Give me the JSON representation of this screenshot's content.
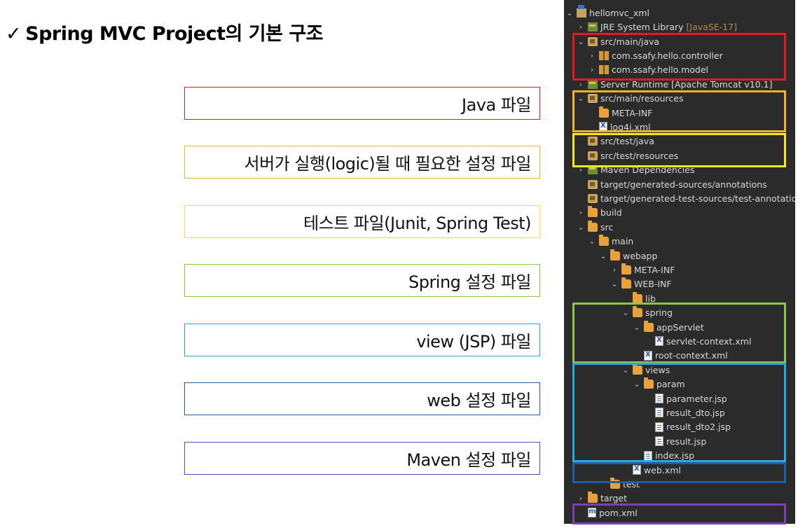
{
  "title": {
    "check": "✓",
    "text": "Spring MVC Project의 기본 구조"
  },
  "colors": {
    "red": "#e21b1b",
    "orange": "#f0b323",
    "yellow": "#f2ea1a",
    "green": "#8dc63f",
    "sky": "#27aae1",
    "blue": "#1c5ea8",
    "purple": "#7d3fb5"
  },
  "descriptions": [
    {
      "label": "Java 파일"
    },
    {
      "label": "서버가 실행(logic)될 때 필요한 설정 파일"
    },
    {
      "label": "테스트 파일(Junit, Spring Test)"
    },
    {
      "label": "Spring 설정 파일"
    },
    {
      "label": "view (JSP) 파일"
    },
    {
      "label": "web 설정 파일"
    },
    {
      "label": "Maven 설정 파일"
    }
  ],
  "tree": [
    {
      "label": "hellomvc_xml",
      "icon": "project-icon",
      "chevron": "open"
    },
    {
      "label": "JRE System Library",
      "extra": "[JavaSE-17]",
      "icon": "library-icon",
      "chevron": "closed"
    },
    {
      "label": "src/main/java",
      "icon": "package-folder-icon",
      "chevron": "open"
    },
    {
      "label": "com.ssafy.hello.controller",
      "icon": "package-icon",
      "chevron": "closed"
    },
    {
      "label": "com.ssafy.hello.model",
      "icon": "package-icon",
      "chevron": "closed"
    },
    {
      "label": "Server Runtime [Apache Tomcat v10.1]",
      "icon": "library-icon",
      "chevron": "closed"
    },
    {
      "label": "src/main/resources",
      "icon": "package-folder-icon",
      "chevron": "open"
    },
    {
      "label": "META-INF",
      "icon": "folder-icon",
      "chevron": "none"
    },
    {
      "label": "log4j.xml",
      "icon": "xml-file-icon",
      "chevron": "none"
    },
    {
      "label": "src/test/java",
      "icon": "package-folder-icon",
      "chevron": "none"
    },
    {
      "label": "src/test/resources",
      "icon": "package-folder-icon",
      "chevron": "none"
    },
    {
      "label": "Maven Dependencies",
      "icon": "library-icon",
      "chevron": "closed"
    },
    {
      "label": "target/generated-sources/annotations",
      "icon": "package-folder-icon",
      "chevron": "none"
    },
    {
      "label": "target/generated-test-sources/test-annotations",
      "icon": "package-folder-icon",
      "chevron": "none"
    },
    {
      "label": "build",
      "icon": "folder-icon",
      "chevron": "closed"
    },
    {
      "label": "src",
      "icon": "folder-icon",
      "chevron": "open"
    },
    {
      "label": "main",
      "icon": "folder-icon",
      "chevron": "open"
    },
    {
      "label": "webapp",
      "icon": "folder-icon",
      "chevron": "open"
    },
    {
      "label": "META-INF",
      "icon": "folder-icon",
      "chevron": "closed"
    },
    {
      "label": "WEB-INF",
      "icon": "folder-icon",
      "chevron": "open"
    },
    {
      "label": "lib",
      "icon": "folder-icon",
      "chevron": "none"
    },
    {
      "label": "spring",
      "icon": "folder-icon",
      "chevron": "open"
    },
    {
      "label": "appServlet",
      "icon": "folder-icon",
      "chevron": "open"
    },
    {
      "label": "servlet-context.xml",
      "icon": "xml-file-icon",
      "chevron": "none"
    },
    {
      "label": "root-context.xml",
      "icon": "xml-file-icon",
      "chevron": "none"
    },
    {
      "label": "views",
      "icon": "folder-icon",
      "chevron": "open"
    },
    {
      "label": "param",
      "icon": "folder-icon",
      "chevron": "open"
    },
    {
      "label": "parameter.jsp",
      "icon": "jsp-file-icon",
      "chevron": "none"
    },
    {
      "label": "result_dto.jsp",
      "icon": "jsp-file-icon",
      "chevron": "none"
    },
    {
      "label": "result_dto2.jsp",
      "icon": "jsp-file-icon",
      "chevron": "none"
    },
    {
      "label": "result.jsp",
      "icon": "jsp-file-icon",
      "chevron": "none"
    },
    {
      "label": "index.jsp",
      "icon": "jsp-file-icon",
      "chevron": "none"
    },
    {
      "label": "web.xml",
      "icon": "xml-file-icon",
      "chevron": "none"
    },
    {
      "label": "test",
      "icon": "folder-icon",
      "chevron": "none"
    },
    {
      "label": "target",
      "icon": "folder-icon",
      "chevron": "closed"
    },
    {
      "label": "pom.xml",
      "icon": "pom-file-icon",
      "chevron": "none"
    }
  ]
}
